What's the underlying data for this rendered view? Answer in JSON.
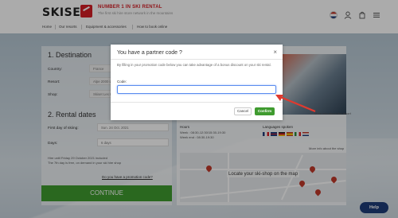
{
  "header": {
    "logo": "SKISET",
    "tagline_main": "NUMBER 1 IN SKI RENTAL",
    "tagline_sub": "The first ski hire store network in the mountains",
    "nav": [
      "Home",
      "Our resorts",
      "Equipment & accessories",
      "How to book online"
    ]
  },
  "booking": {
    "destination_title": "1. Destination",
    "country_label": "Country:",
    "country_value": "France",
    "resort_label": "Resort:",
    "resort_value": "Alpe 2000 La Plagne",
    "shop_label": "Shop:",
    "shop_value": "Skiset Les Hauts Lieux",
    "rental_title": "2. Rental dates",
    "first_day_label": "First day of skiing:",
    "first_day_value": "Sun. 24 Oct. 2021",
    "days_label": "Days:",
    "days_value": "6 days",
    "info_line1": "Hire until Friday 29 October 2021 included",
    "info_line2": "The 7th day is free, on demand in your ski hire shop",
    "promo_link": "Do you have a promotion code?",
    "continue": "CONTINUE"
  },
  "shop_info": {
    "photo_caption": "More info about the resort",
    "hours_label": "Hours",
    "hours_week": "Week : 08:30-12:30/15:30-19:30",
    "hours_weekend": "Week end : 08:30-19:30",
    "languages_label": "Languages spoken",
    "map_caption": "More info about the shop",
    "map_locate": "Locate your ski-shop on the map"
  },
  "help": "Help",
  "modal": {
    "title": "You have a partner code ?",
    "close": "×",
    "description": "By filling in your promotion code below you can take advantage of a bonus discount on your ski rental.",
    "code_label": "Code:",
    "code_value": "",
    "cancel": "Cancel",
    "confirm": "Confirm"
  },
  "colors": {
    "brand_red": "#d61f26",
    "confirm_green": "#3f9b2f",
    "help_navy": "#1f3d7a"
  }
}
